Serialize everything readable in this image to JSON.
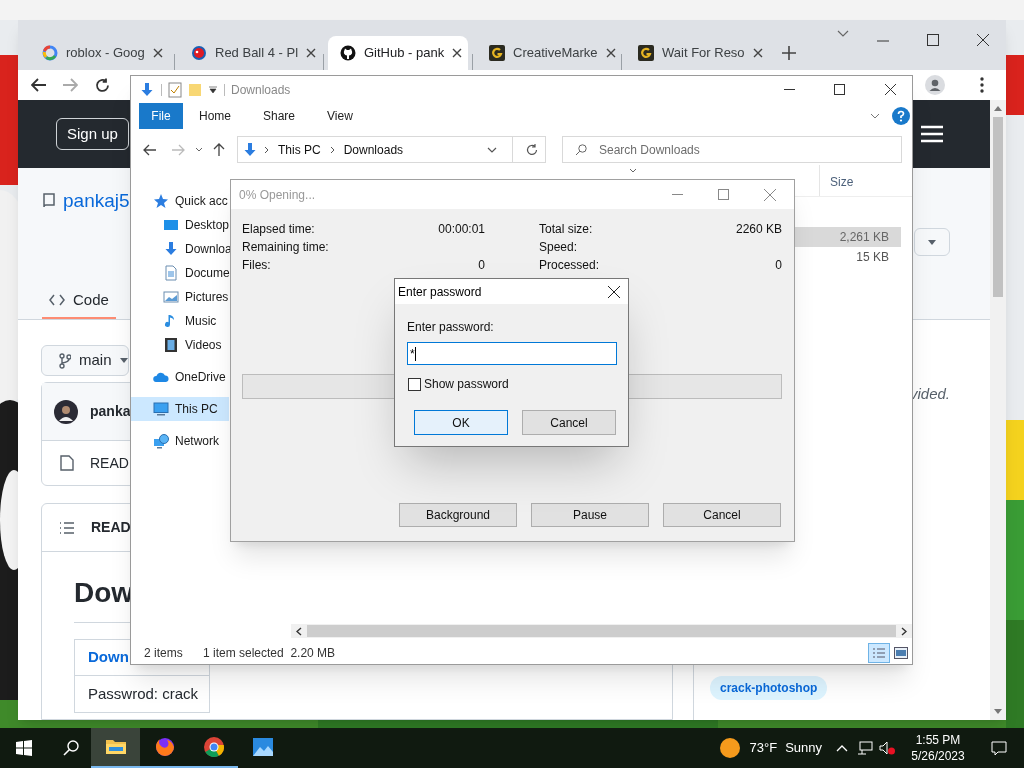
{
  "browser": {
    "tabs": [
      {
        "title": "roblox - Goog",
        "kind": "ring",
        "selected": false
      },
      {
        "title": "Red Ball 4 - Pl",
        "kind": "ball",
        "selected": false
      },
      {
        "title": "GitHub - pank",
        "kind": "octo",
        "selected": true
      },
      {
        "title": "CreativeMarke",
        "kind": "square",
        "selected": false
      },
      {
        "title": "Wait For Reso",
        "kind": "square",
        "selected": false
      }
    ]
  },
  "github": {
    "sign_up": "Sign up",
    "repo_name": "pankaj5",
    "tabs": [
      {
        "label": "Code",
        "selected": true
      }
    ],
    "branch": "main",
    "commit_author": "panka",
    "file_name": "READ",
    "readme_title": "READ",
    "heading": "Dow",
    "table_rows": [
      {
        "text": "Down",
        "kind": "link"
      },
      {
        "text": "Passwrod: crack",
        "kind": "text"
      }
    ],
    "about_text": "vided.",
    "topics": [
      "crack-photoshop"
    ]
  },
  "explorer": {
    "title": "Downloads",
    "file_tab": "File",
    "ribbon_tabs": [
      "Home",
      "Share",
      "View"
    ],
    "path": [
      "This PC",
      "Downloads"
    ],
    "search": {
      "placeholder": "Search Downloads"
    },
    "nav": [
      {
        "label": "Quick acc",
        "kind": "star",
        "selected": false,
        "children": [
          {
            "label": "Desktop",
            "kind": "desktop",
            "selected": false
          },
          {
            "label": "Downloa",
            "kind": "download",
            "selected": false
          },
          {
            "label": "Docume",
            "kind": "document",
            "selected": false
          },
          {
            "label": "Pictures",
            "kind": "pictures",
            "selected": false
          },
          {
            "label": "Music",
            "kind": "music",
            "selected": false
          },
          {
            "label": "Videos",
            "kind": "videos",
            "selected": false
          }
        ]
      },
      {
        "label": "OneDrive",
        "kind": "cloud",
        "selected": false
      },
      {
        "label": "This PC",
        "kind": "computer",
        "selected": true
      },
      {
        "label": "Network",
        "kind": "network",
        "selected": false
      }
    ],
    "columns": [
      "Size"
    ],
    "files": [
      {
        "size": "2,261 KB",
        "selected": true
      },
      {
        "size": "15 KB",
        "selected": false
      }
    ],
    "status": {
      "count": "2 items",
      "selection": "1 item selected  2.20 MB"
    }
  },
  "progress_dialog": {
    "title": "0% Opening...",
    "left_stats": [
      {
        "label": "Elapsed time:",
        "value": "00:00:01"
      },
      {
        "label": "Remaining time:"
      },
      {
        "label": "Files:",
        "value": "0"
      }
    ],
    "right_stats": [
      {
        "label": "Total size:",
        "value": "2260 KB"
      },
      {
        "label": "Speed:"
      },
      {
        "label": "Processed:",
        "value": "0"
      }
    ],
    "level": 0,
    "buttons": [
      "Background",
      "Pause",
      "Cancel"
    ]
  },
  "password_dialog": {
    "title": "Enter password",
    "label": "Enter password:",
    "value": "*",
    "show_password": {
      "label": "Show password",
      "checked": false
    },
    "buttons": [
      {
        "label": "OK",
        "default": true
      },
      {
        "label": "Cancel",
        "default": false
      }
    ]
  },
  "taskbar": {
    "apps": [
      {
        "kind": "folder",
        "selected": true,
        "running": true
      },
      {
        "kind": "fox",
        "selected": false,
        "running": true
      },
      {
        "kind": "chrome",
        "selected": false,
        "running": true
      },
      {
        "kind": "photos",
        "selected": false,
        "running": false
      }
    ],
    "temperature": "73°F",
    "weather": "Sunny",
    "time": "1:55 PM",
    "date": "5/26/2023"
  }
}
